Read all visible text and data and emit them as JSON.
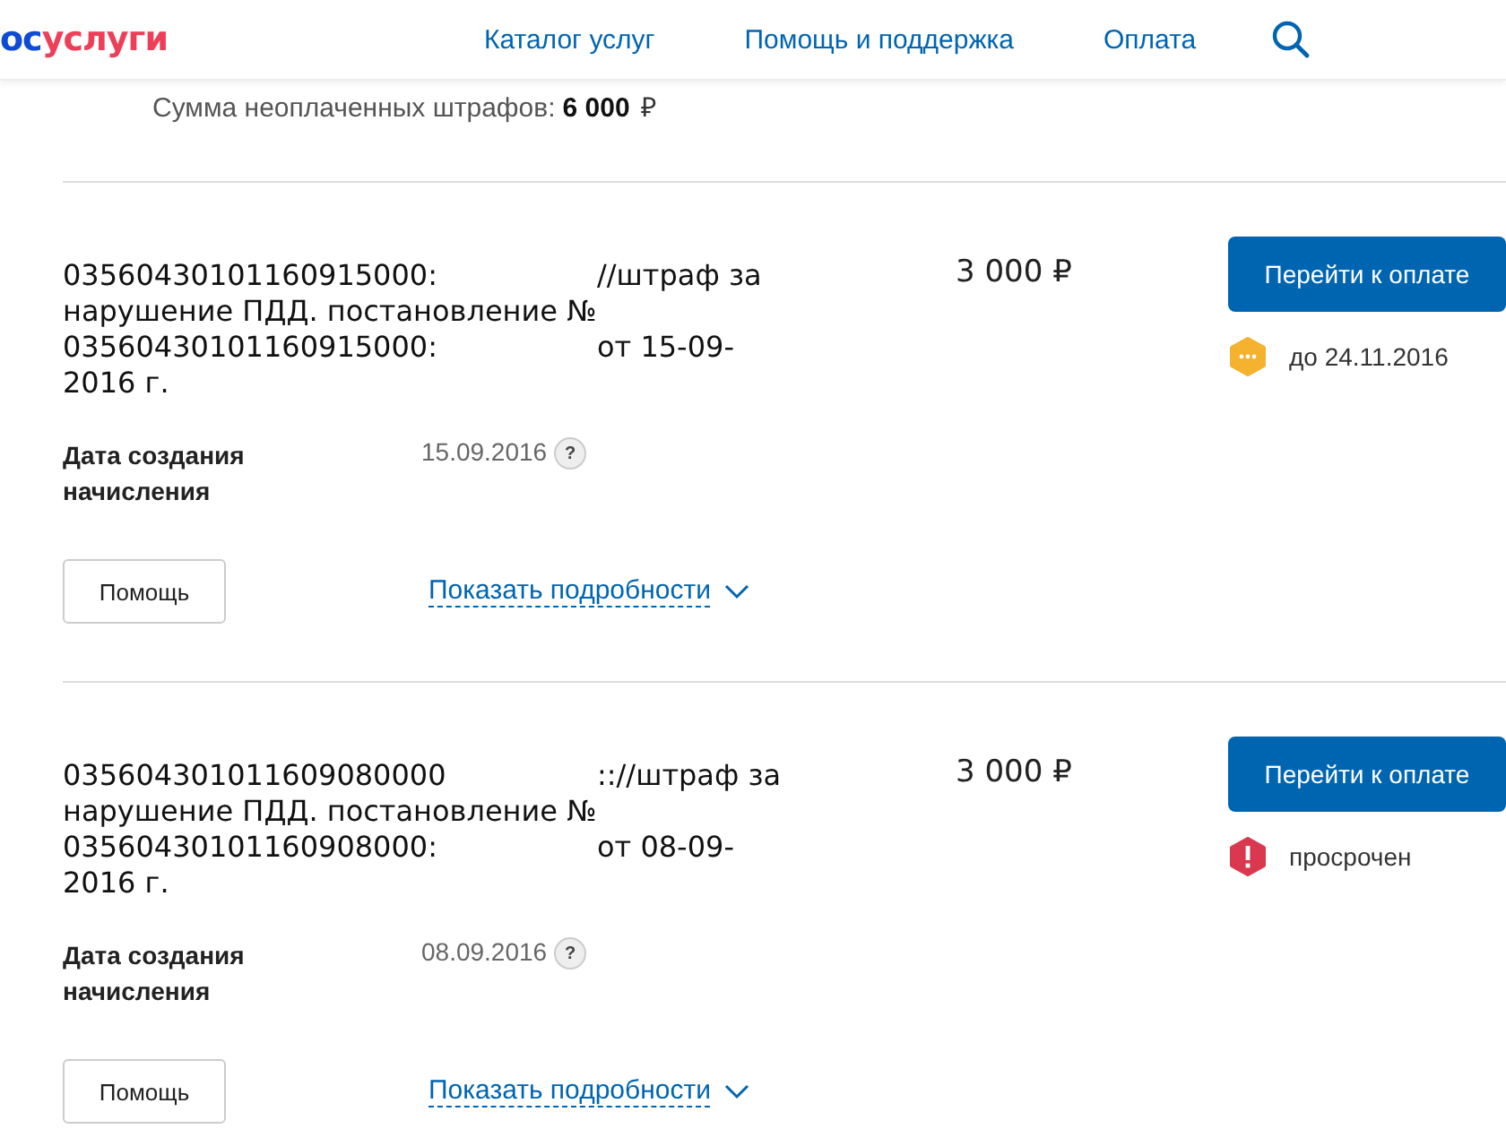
{
  "header": {
    "logo": {
      "prefix": "ос",
      "name": "услуги"
    },
    "nav": [
      "Каталог услуг",
      "Помощь и поддержка",
      "Оплата"
    ]
  },
  "summary": {
    "label": "Сумма неоплаченных штрафов:",
    "amount": "6 000",
    "currency": "₽"
  },
  "fines": [
    {
      "description": [
        [
          "03560430101160915000:",
          "//штраф за"
        ],
        [
          "нарушение ПДД. постановление №"
        ],
        [
          "03560430101160915000:",
          "от 15-09-"
        ],
        [
          "2016 г."
        ]
      ],
      "amount": "3 000 ₽",
      "pay_button": "Перейти к оплате",
      "status": {
        "kind": "pending",
        "text": "до 24.11.2016"
      },
      "date_label": "Дата создания начисления",
      "date": "15.09.2016",
      "date_hint": "?",
      "help_button": "Помощь",
      "details_link": "Показать подробности"
    },
    {
      "description": [
        [
          "035604301011609080000",
          ":://штраф за"
        ],
        [
          "нарушение ПДД. постановление №"
        ],
        [
          "03560430101160908000:",
          "от 08-09-"
        ],
        [
          "2016 г."
        ]
      ],
      "amount": "3 000 ₽",
      "pay_button": "Перейти к оплате",
      "status": {
        "kind": "overdue",
        "text": "просрочен"
      },
      "date_label": "Дата создания начисления",
      "date": "08.09.2016",
      "date_hint": "?",
      "help_button": "Помощь",
      "details_link": "Показать подробности"
    }
  ]
}
